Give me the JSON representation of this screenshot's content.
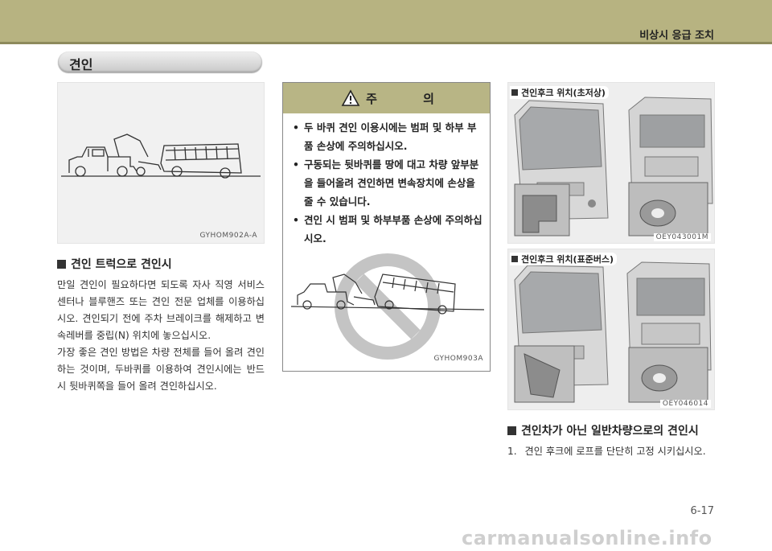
{
  "header": {
    "chapter_title": "비상시 응급 조치"
  },
  "section": {
    "title": "견인"
  },
  "figure1": {
    "code": "GYHOM902A-A"
  },
  "subsection1": {
    "title": "견인 트럭으로 견인시",
    "para1": "만일 견인이 필요하다면 되도록 자사 직영 서비스센터나 블루핸즈 또는 견인 전문 업체를 이용하십시오. 견인되기 전에 주차 브레이크를 해제하고 변속레버를 중립(N) 위치에 놓으십시오.",
    "para2": "가장 좋은 견인 방법은 차량 전체를 들어 올려 견인하는 것이며, 두바퀴를 이용하여 견인시에는 반드시 뒷바퀴쪽을 들어 올려 견인하십시오."
  },
  "caution": {
    "icon": "warning-triangle-icon",
    "title": "주 의",
    "items": [
      "두 바퀴 견인 이용시에는 범퍼 및 하부 부품 손상에 주의하십시오.",
      "구동되는 뒷바퀴를 땅에 대고 차량 앞부분을 들어올려 견인하면 변속장치에 손상을 줄 수 있습니다.",
      "견인 시 범퍼 및 하부부품 손상에 주의하십시오."
    ],
    "figure_code": "GYHOM903A"
  },
  "photo1": {
    "label": "견인후크 위치(초저상)",
    "code": "OEY043001M"
  },
  "photo2": {
    "label": "견인후크 위치(표준버스)",
    "code": "OEY046014"
  },
  "subsection2": {
    "title": "견인차가 아닌 일반차량으로의 견인시",
    "step1_num": "1.",
    "step1": "견인 후크에 로프를 단단히 고정 시키십시오."
  },
  "footer": {
    "page_number": "6-17",
    "watermark": "carmanualsonline.info"
  },
  "colors": {
    "header_band": "#b7b381",
    "caution_header": "#b8b585"
  }
}
